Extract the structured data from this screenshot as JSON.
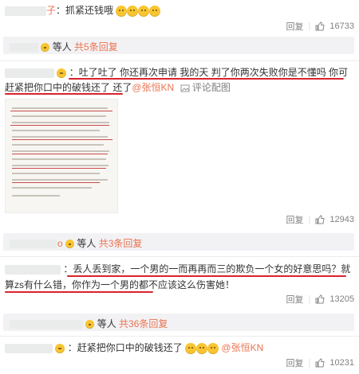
{
  "comments": [
    {
      "text_prefix": "",
      "name": "子",
      "text": "：抓紧还钱哦",
      "reply": "回复",
      "likes": "16733"
    },
    {
      "sub": {
        "suffix": "等人",
        "link": "共5条回复"
      }
    },
    {
      "name": "",
      "text": "：吐了吐了 你还再次申请 我的天 判了你两次失败你是不懂吗 你可赶紧把你口中的破钱还了 还了",
      "mention": "@张恒KN",
      "image_link": "评论配图",
      "reply": "回复",
      "likes": "12943"
    },
    {
      "sub": {
        "name": "o",
        "suffix": "等人",
        "link": "共3条回复"
      }
    },
    {
      "text": "：丢人丢到家，一个男的一而再再而三的欺负一个女的好意思吗？就算zs有什么错，你作为一个男的都不应该这么伤害她！",
      "reply": "回复",
      "likes": "13205"
    },
    {
      "sub": {
        "suffix": "等人",
        "link": "共36条回复"
      }
    },
    {
      "text": "：赶紧把你口中的破钱还了",
      "mention": "@张恒KN",
      "reply": "回复",
      "likes": "10231"
    }
  ]
}
